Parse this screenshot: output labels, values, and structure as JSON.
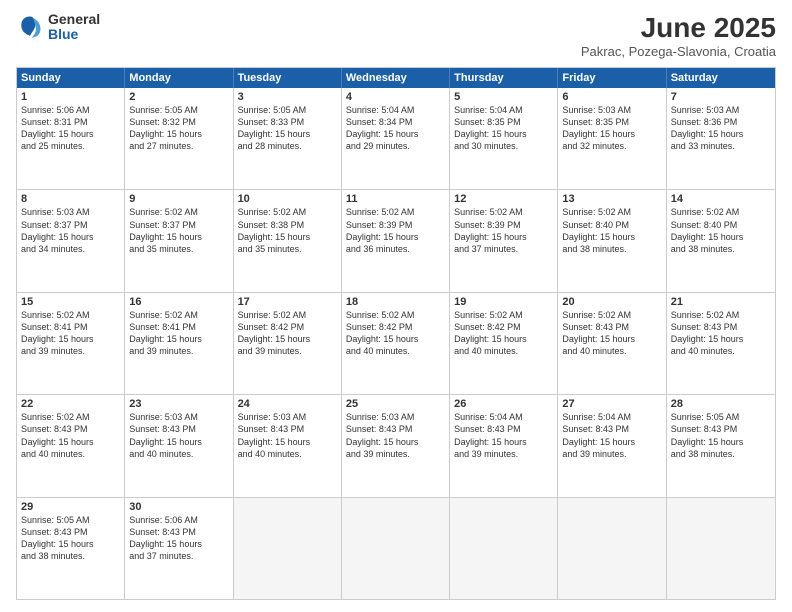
{
  "logo": {
    "general": "General",
    "blue": "Blue"
  },
  "title": "June 2025",
  "location": "Pakrac, Pozega-Slavonia, Croatia",
  "header": {
    "days": [
      "Sunday",
      "Monday",
      "Tuesday",
      "Wednesday",
      "Thursday",
      "Friday",
      "Saturday"
    ]
  },
  "rows": [
    [
      {
        "day": "1",
        "lines": [
          "Sunrise: 5:06 AM",
          "Sunset: 8:31 PM",
          "Daylight: 15 hours",
          "and 25 minutes."
        ]
      },
      {
        "day": "2",
        "lines": [
          "Sunrise: 5:05 AM",
          "Sunset: 8:32 PM",
          "Daylight: 15 hours",
          "and 27 minutes."
        ]
      },
      {
        "day": "3",
        "lines": [
          "Sunrise: 5:05 AM",
          "Sunset: 8:33 PM",
          "Daylight: 15 hours",
          "and 28 minutes."
        ]
      },
      {
        "day": "4",
        "lines": [
          "Sunrise: 5:04 AM",
          "Sunset: 8:34 PM",
          "Daylight: 15 hours",
          "and 29 minutes."
        ]
      },
      {
        "day": "5",
        "lines": [
          "Sunrise: 5:04 AM",
          "Sunset: 8:35 PM",
          "Daylight: 15 hours",
          "and 30 minutes."
        ]
      },
      {
        "day": "6",
        "lines": [
          "Sunrise: 5:03 AM",
          "Sunset: 8:35 PM",
          "Daylight: 15 hours",
          "and 32 minutes."
        ]
      },
      {
        "day": "7",
        "lines": [
          "Sunrise: 5:03 AM",
          "Sunset: 8:36 PM",
          "Daylight: 15 hours",
          "and 33 minutes."
        ]
      }
    ],
    [
      {
        "day": "8",
        "lines": [
          "Sunrise: 5:03 AM",
          "Sunset: 8:37 PM",
          "Daylight: 15 hours",
          "and 34 minutes."
        ]
      },
      {
        "day": "9",
        "lines": [
          "Sunrise: 5:02 AM",
          "Sunset: 8:37 PM",
          "Daylight: 15 hours",
          "and 35 minutes."
        ]
      },
      {
        "day": "10",
        "lines": [
          "Sunrise: 5:02 AM",
          "Sunset: 8:38 PM",
          "Daylight: 15 hours",
          "and 35 minutes."
        ]
      },
      {
        "day": "11",
        "lines": [
          "Sunrise: 5:02 AM",
          "Sunset: 8:39 PM",
          "Daylight: 15 hours",
          "and 36 minutes."
        ]
      },
      {
        "day": "12",
        "lines": [
          "Sunrise: 5:02 AM",
          "Sunset: 8:39 PM",
          "Daylight: 15 hours",
          "and 37 minutes."
        ]
      },
      {
        "day": "13",
        "lines": [
          "Sunrise: 5:02 AM",
          "Sunset: 8:40 PM",
          "Daylight: 15 hours",
          "and 38 minutes."
        ]
      },
      {
        "day": "14",
        "lines": [
          "Sunrise: 5:02 AM",
          "Sunset: 8:40 PM",
          "Daylight: 15 hours",
          "and 38 minutes."
        ]
      }
    ],
    [
      {
        "day": "15",
        "lines": [
          "Sunrise: 5:02 AM",
          "Sunset: 8:41 PM",
          "Daylight: 15 hours",
          "and 39 minutes."
        ]
      },
      {
        "day": "16",
        "lines": [
          "Sunrise: 5:02 AM",
          "Sunset: 8:41 PM",
          "Daylight: 15 hours",
          "and 39 minutes."
        ]
      },
      {
        "day": "17",
        "lines": [
          "Sunrise: 5:02 AM",
          "Sunset: 8:42 PM",
          "Daylight: 15 hours",
          "and 39 minutes."
        ]
      },
      {
        "day": "18",
        "lines": [
          "Sunrise: 5:02 AM",
          "Sunset: 8:42 PM",
          "Daylight: 15 hours",
          "and 40 minutes."
        ]
      },
      {
        "day": "19",
        "lines": [
          "Sunrise: 5:02 AM",
          "Sunset: 8:42 PM",
          "Daylight: 15 hours",
          "and 40 minutes."
        ]
      },
      {
        "day": "20",
        "lines": [
          "Sunrise: 5:02 AM",
          "Sunset: 8:43 PM",
          "Daylight: 15 hours",
          "and 40 minutes."
        ]
      },
      {
        "day": "21",
        "lines": [
          "Sunrise: 5:02 AM",
          "Sunset: 8:43 PM",
          "Daylight: 15 hours",
          "and 40 minutes."
        ]
      }
    ],
    [
      {
        "day": "22",
        "lines": [
          "Sunrise: 5:02 AM",
          "Sunset: 8:43 PM",
          "Daylight: 15 hours",
          "and 40 minutes."
        ]
      },
      {
        "day": "23",
        "lines": [
          "Sunrise: 5:03 AM",
          "Sunset: 8:43 PM",
          "Daylight: 15 hours",
          "and 40 minutes."
        ]
      },
      {
        "day": "24",
        "lines": [
          "Sunrise: 5:03 AM",
          "Sunset: 8:43 PM",
          "Daylight: 15 hours",
          "and 40 minutes."
        ]
      },
      {
        "day": "25",
        "lines": [
          "Sunrise: 5:03 AM",
          "Sunset: 8:43 PM",
          "Daylight: 15 hours",
          "and 39 minutes."
        ]
      },
      {
        "day": "26",
        "lines": [
          "Sunrise: 5:04 AM",
          "Sunset: 8:43 PM",
          "Daylight: 15 hours",
          "and 39 minutes."
        ]
      },
      {
        "day": "27",
        "lines": [
          "Sunrise: 5:04 AM",
          "Sunset: 8:43 PM",
          "Daylight: 15 hours",
          "and 39 minutes."
        ]
      },
      {
        "day": "28",
        "lines": [
          "Sunrise: 5:05 AM",
          "Sunset: 8:43 PM",
          "Daylight: 15 hours",
          "and 38 minutes."
        ]
      }
    ],
    [
      {
        "day": "29",
        "lines": [
          "Sunrise: 5:05 AM",
          "Sunset: 8:43 PM",
          "Daylight: 15 hours",
          "and 38 minutes."
        ]
      },
      {
        "day": "30",
        "lines": [
          "Sunrise: 5:06 AM",
          "Sunset: 8:43 PM",
          "Daylight: 15 hours",
          "and 37 minutes."
        ]
      },
      {
        "day": "",
        "lines": []
      },
      {
        "day": "",
        "lines": []
      },
      {
        "day": "",
        "lines": []
      },
      {
        "day": "",
        "lines": []
      },
      {
        "day": "",
        "lines": []
      }
    ]
  ]
}
